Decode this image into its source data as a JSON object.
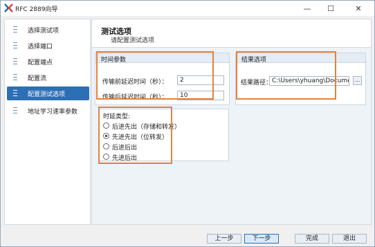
{
  "window": {
    "title": "RFC 2889向导",
    "minimize_glyph": "—",
    "maximize_glyph": "☐",
    "close_glyph": "✕",
    "accent_color": "#2d6fb5",
    "highlight_color": "#e8803a"
  },
  "sidebar": {
    "items": [
      {
        "label": "选择测试项",
        "active": false
      },
      {
        "label": "选择端口",
        "active": false
      },
      {
        "label": "配置端点",
        "active": false
      },
      {
        "label": "配置流",
        "active": false
      },
      {
        "label": "配置测试选项",
        "active": true
      },
      {
        "label": "地址学习速率参数",
        "active": false
      }
    ]
  },
  "header": {
    "title": "测试选项",
    "subtitle": "请配置测试选项"
  },
  "time_params": {
    "title": "时间参数",
    "pre_delay_label": "传输前延迟时间（秒）：",
    "pre_delay_value": "2",
    "post_delay_label": "传输后延迟时间（秒）：",
    "post_delay_value": "10"
  },
  "result_options": {
    "title": "结果选项",
    "path_label": "结果路径：",
    "path_value": "C:\\Users\\yhuang\\Documents\\Xinertel",
    "browse_label": "..."
  },
  "latency_type": {
    "title": "时延类型:",
    "options": [
      {
        "label": "后进先出（存储和转发）",
        "checked": false
      },
      {
        "label": "先进先出（位转发）",
        "checked": true
      },
      {
        "label": "后进后出",
        "checked": false
      },
      {
        "label": "先进后出",
        "checked": false
      }
    ]
  },
  "footer": {
    "prev_label": "上一步",
    "next_label": "下一步",
    "finish_label": "完成",
    "exit_label": "退出"
  }
}
